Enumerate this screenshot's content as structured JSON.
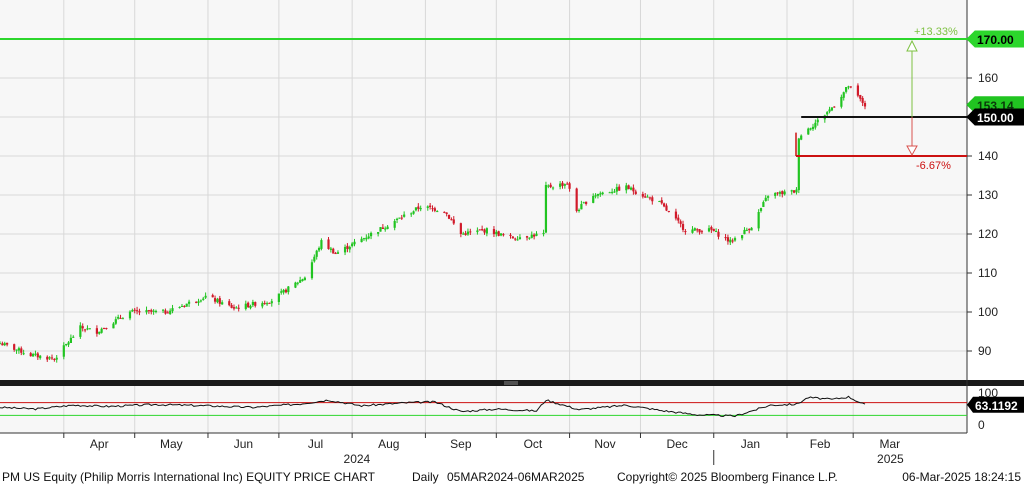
{
  "chart_data": {
    "type": "candlestick",
    "title": "PM US Equity (Philip Morris International Inc) EQUITY PRICE CHART",
    "frequency": "Daily",
    "period": "05MAR2024-06MAR2025",
    "copyright": "Copyright© 2025 Bloomberg Finance L.P.",
    "timestamp": "06-Mar-2025 18:24:15",
    "ylim": [
      82,
      176
    ],
    "yticks": [
      "90",
      "100",
      "110",
      "120",
      "130",
      "140",
      "150",
      "160"
    ],
    "months": [
      "Apr",
      "May",
      "Jun",
      "Jul",
      "Aug",
      "Sep",
      "Oct",
      "Nov",
      "Dec",
      "Jan",
      "Feb",
      "Mar"
    ],
    "years": [
      "2024",
      "2025"
    ],
    "colors": {
      "up": "#21c421",
      "down": "#d11a2a",
      "ref_green": "#2cd62c",
      "ref_red": "#cc1111",
      "grid": "#d8d8d8"
    },
    "price_path": [
      [
        "2024-03-05",
        92
      ],
      [
        "2024-03-18",
        89
      ],
      [
        "2024-03-28",
        88
      ],
      [
        "2024-04-08",
        96
      ],
      [
        "2024-04-15",
        95
      ],
      [
        "2024-04-29",
        100
      ],
      [
        "2024-05-14",
        100
      ],
      [
        "2024-05-31",
        104
      ],
      [
        "2024-06-12",
        101
      ],
      [
        "2024-06-28",
        103
      ],
      [
        "2024-07-12",
        109
      ],
      [
        "2024-07-19",
        118
      ],
      [
        "2024-07-25",
        115
      ],
      [
        "2024-08-12",
        121
      ],
      [
        "2024-08-30",
        127
      ],
      [
        "2024-09-09",
        126
      ],
      [
        "2024-09-16",
        120
      ],
      [
        "2024-09-27",
        121
      ],
      [
        "2024-10-07",
        119
      ],
      [
        "2024-10-21",
        120
      ],
      [
        "2024-10-22",
        132
      ],
      [
        "2024-10-31",
        133
      ],
      [
        "2024-11-04",
        126
      ],
      [
        "2024-11-11",
        130
      ],
      [
        "2024-11-25",
        132
      ],
      [
        "2024-12-09",
        128
      ],
      [
        "2024-12-20",
        121
      ],
      [
        "2024-12-31",
        121
      ],
      [
        "2025-01-08",
        118
      ],
      [
        "2025-01-17",
        122
      ],
      [
        "2025-01-24",
        130
      ],
      [
        "2025-02-05",
        131
      ],
      [
        "2025-02-06",
        145
      ],
      [
        "2025-02-14",
        149
      ],
      [
        "2025-02-21",
        153
      ],
      [
        "2025-02-27",
        158
      ],
      [
        "2025-03-06",
        153
      ]
    ],
    "last_price": "153.14",
    "reference_lines": [
      {
        "value": 170,
        "label": "170.00",
        "pct": "+13.33%"
      },
      {
        "value": 150,
        "label": "150.00"
      },
      {
        "value": 140,
        "pct": "-6.67%"
      }
    ],
    "rsi": {
      "value": "63.1192",
      "ticks": [
        "100",
        "0"
      ],
      "upper": 70,
      "lower": 30,
      "path": [
        [
          "2024-03-05",
          55
        ],
        [
          "2024-03-20",
          50
        ],
        [
          "2024-04-05",
          62
        ],
        [
          "2024-04-20",
          58
        ],
        [
          "2024-05-10",
          64
        ],
        [
          "2024-06-01",
          60
        ],
        [
          "2024-06-20",
          55
        ],
        [
          "2024-07-10",
          66
        ],
        [
          "2024-07-22",
          78
        ],
        [
          "2024-08-05",
          60
        ],
        [
          "2024-08-25",
          70
        ],
        [
          "2024-09-05",
          72
        ],
        [
          "2024-09-16",
          42
        ],
        [
          "2024-10-01",
          50
        ],
        [
          "2024-10-18",
          44
        ],
        [
          "2024-10-22",
          78
        ],
        [
          "2024-11-05",
          48
        ],
        [
          "2024-11-25",
          62
        ],
        [
          "2024-12-10",
          45
        ],
        [
          "2024-12-25",
          32
        ],
        [
          "2025-01-10",
          28
        ],
        [
          "2025-01-25",
          62
        ],
        [
          "2025-02-05",
          65
        ],
        [
          "2025-02-10",
          86
        ],
        [
          "2025-02-20",
          80
        ],
        [
          "2025-02-27",
          88
        ],
        [
          "2025-03-06",
          63
        ]
      ]
    }
  }
}
